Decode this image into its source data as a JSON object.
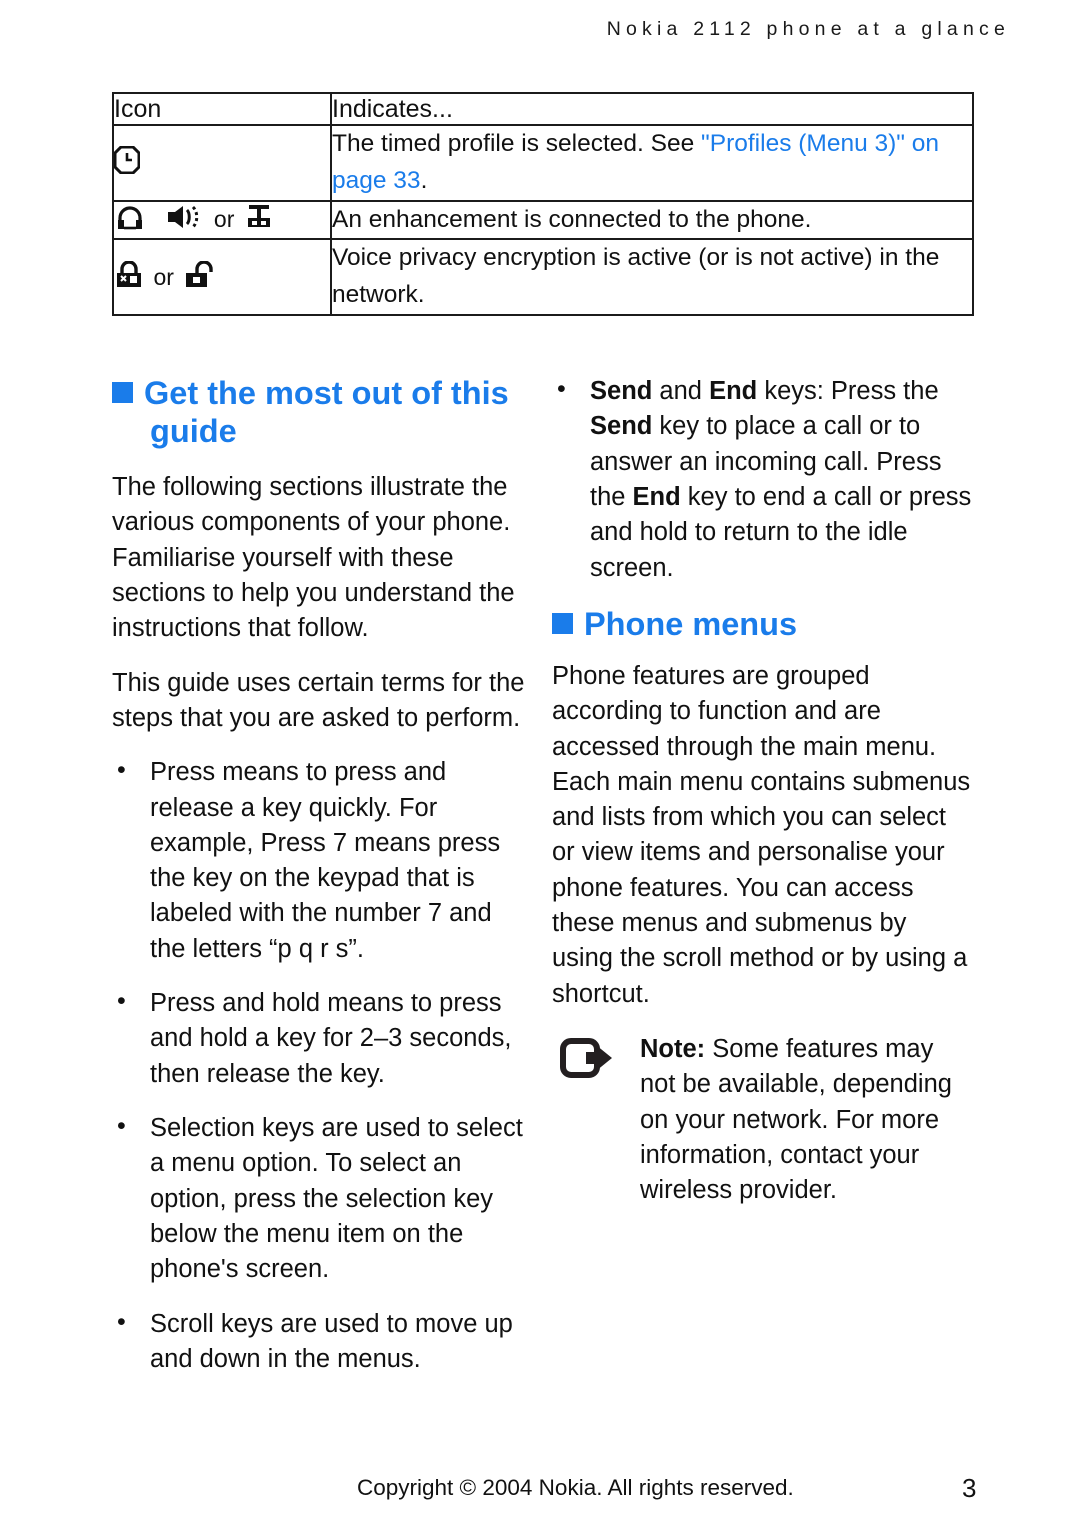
{
  "header": {
    "running_title": "Nokia 2112 phone at a glance"
  },
  "icon_table": {
    "columns": [
      "Icon",
      "Indicates..."
    ],
    "rows": [
      {
        "icons": [
          "clock-icon"
        ],
        "separator": "",
        "text_before_link": "The timed profile is selected. See ",
        "link_text": "\"Profiles (Menu 3)\" on page 33",
        "text_after_link": "."
      },
      {
        "icons": [
          "headset-icon",
          "loudspeaker-icon",
          "tty-device-icon"
        ],
        "separator": "or",
        "text": "An enhancement is connected to the phone."
      },
      {
        "icons": [
          "padlock-closed-icon",
          "padlock-open-icon"
        ],
        "separator": "or",
        "text": "Voice privacy encryption is active (or is not active) in the network."
      }
    ]
  },
  "left_column": {
    "heading": "Get the most out of this guide",
    "paragraphs": [
      "The following sections illustrate the various components of your phone. Familiarise yourself with these sections to help you understand the instructions that follow.",
      "This guide uses certain terms for the steps that you are asked to perform."
    ],
    "bullets": [
      "Press means to press and release a key quickly. For example, Press 7 means press the key on the keypad that is labeled with the number 7 and the letters “p q r s”.",
      "Press and hold means to press and hold a key for 2–3 seconds, then release the key.",
      "Selection keys are used to select a menu option. To select an option, press the selection key below the menu item on the phone's screen.",
      "Scroll keys are used to move up and down in the menus."
    ]
  },
  "right_column": {
    "first_bullet": {
      "seg1": "Send",
      "seg2": " and ",
      "seg3": "End",
      "seg4": " keys: Press the ",
      "seg5": "Send",
      "seg6": " key to place a call or to answer an incoming call. Press the ",
      "seg7": "End",
      "seg8": " key to end a call or press and hold to return to the idle screen."
    },
    "heading": "Phone menus",
    "paragraph": "Phone features are grouped according to function and are accessed through the main menu. Each main menu contains submenus and lists from which you can select or view items and personalise your phone features. You can access these menus and submenus by using the scroll method or by using a shortcut.",
    "note": {
      "label": "Note:",
      "text": " Some features may not be available, depending on your network. For more information, contact your wireless provider."
    }
  },
  "footer": {
    "copyright": "Copyright © 2004 Nokia. All rights reserved.",
    "page_number": "3"
  },
  "colors": {
    "accent_blue": "#1a7cea",
    "text_black": "#111111",
    "rule": "#1b1b1b"
  }
}
